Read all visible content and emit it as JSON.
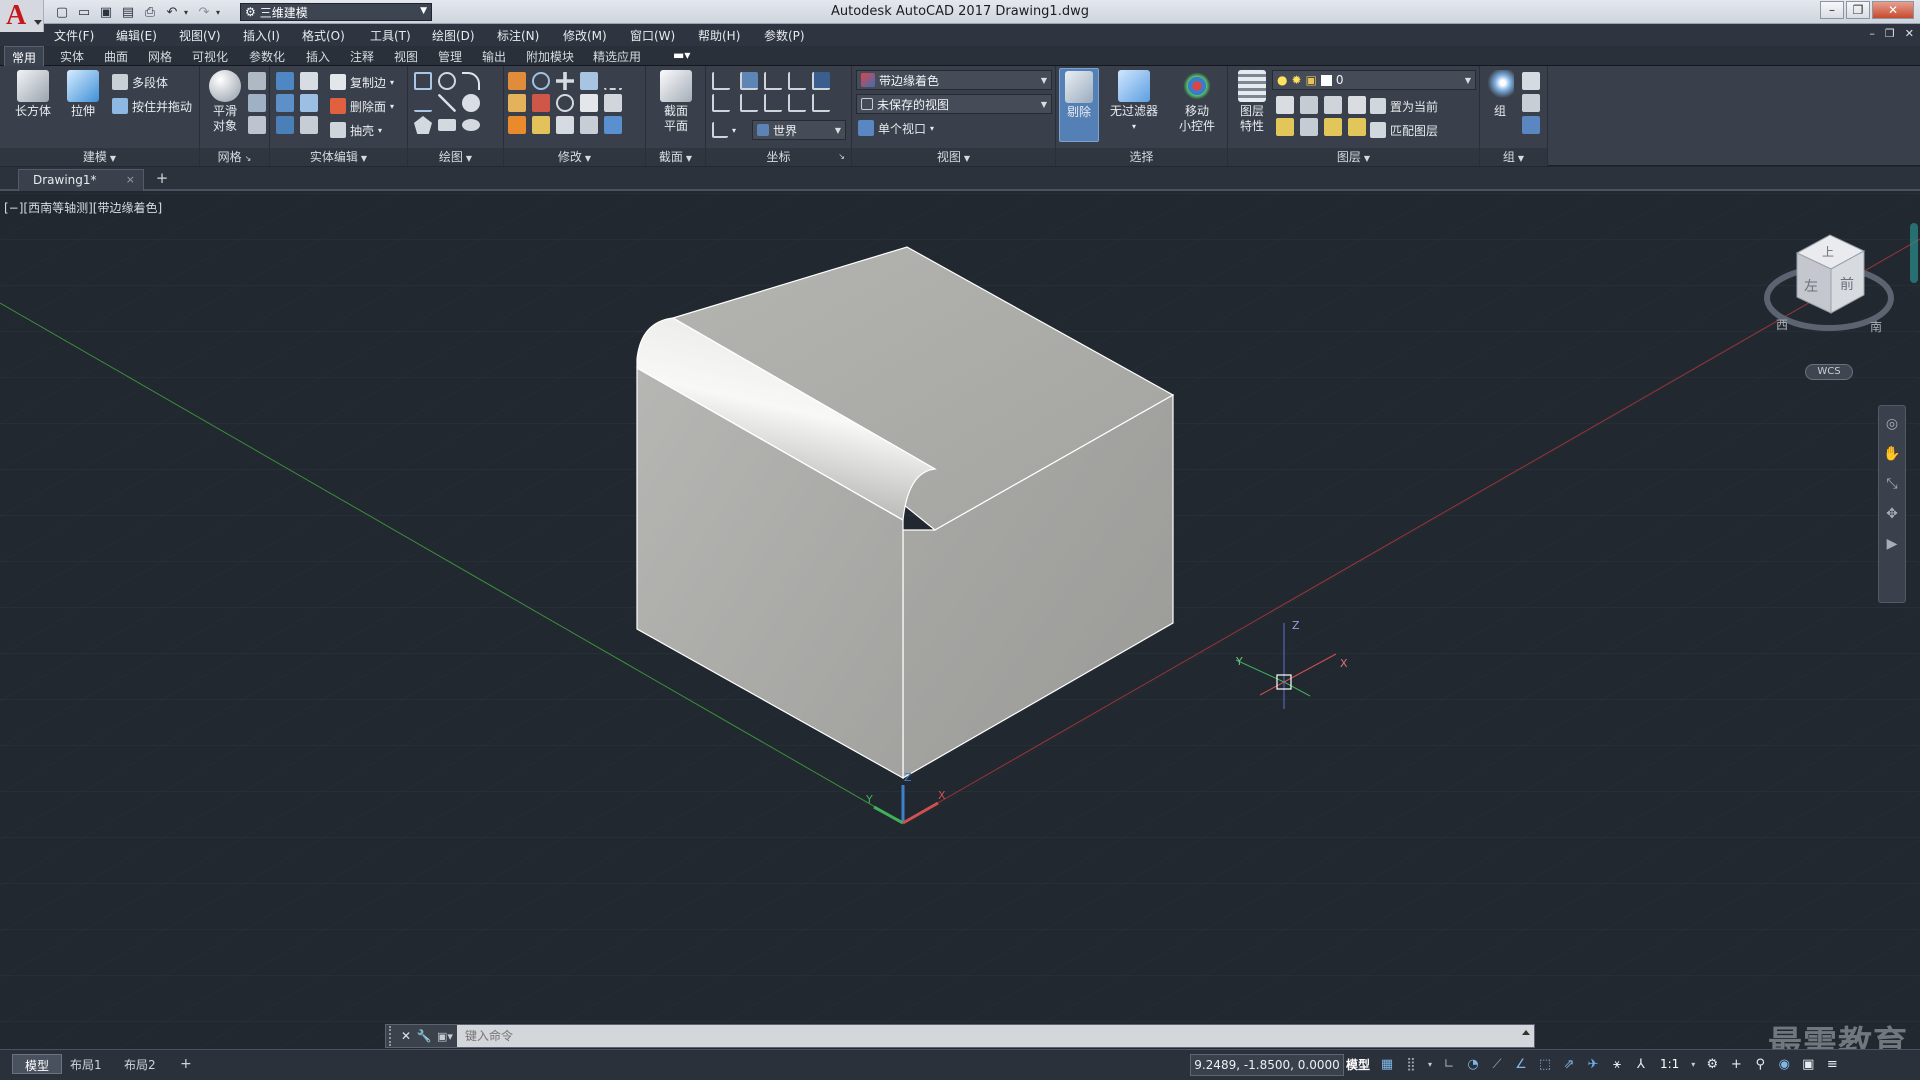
{
  "window": {
    "title": "Autodesk AutoCAD 2017    Drawing1.dwg",
    "app_logo": "A",
    "workspace": "三维建模"
  },
  "menubar": {
    "items": [
      "文件(F)",
      "编辑(E)",
      "视图(V)",
      "插入(I)",
      "格式(O)",
      "工具(T)",
      "绘图(D)",
      "标注(N)",
      "修改(M)",
      "窗口(W)",
      "帮助(H)",
      "参数(P)"
    ]
  },
  "ribbon_tabs": [
    "常用",
    "实体",
    "曲面",
    "网格",
    "可视化",
    "参数化",
    "插入",
    "注释",
    "视图",
    "管理",
    "输出",
    "附加模块",
    "精选应用"
  ],
  "ribbon": {
    "modeling": {
      "title": "建模",
      "box": "长方体",
      "extrude": "拉伸",
      "polysolid": "多段体",
      "presspull": "按住并拖动"
    },
    "mesh": {
      "title": "网格",
      "smooth_line1": "平滑",
      "smooth_line2": "对象"
    },
    "solid_edit": {
      "title": "实体编辑",
      "copy_edges": "复制边",
      "delete_face": "删除面",
      "shell": "抽壳"
    },
    "draw": {
      "title": "绘图"
    },
    "modify": {
      "title": "修改"
    },
    "section": {
      "title": "截面",
      "plane_line1": "截面",
      "plane_line2": "平面"
    },
    "coordinates": {
      "title": "坐标",
      "ucs_value": "世界"
    },
    "view": {
      "title": "视图",
      "visual_style": "带边缘着色",
      "named_view": "未保存的视图",
      "viewport_config": "单个视口"
    },
    "selection": {
      "title": "选择",
      "cull": "剔除",
      "no_filter": "无过滤器",
      "gizmo_line1": "移动",
      "gizmo_line2": "小控件"
    },
    "layers": {
      "title": "图层",
      "properties_line1": "图层",
      "properties_line2": "特性",
      "current_layer": "0",
      "make_current": "置为当前",
      "match_layer": "匹配图层"
    },
    "groups": {
      "title": "组",
      "group": "组"
    }
  },
  "document_tab": {
    "label": "Drawing1*",
    "close": "×",
    "add": "+"
  },
  "viewport": {
    "label": "[−][西南等轴测][带边缘着色]",
    "viewcube": {
      "top_face": "上",
      "left_face": "左",
      "front_face": "前",
      "compass_west": "西",
      "compass_south": "南"
    },
    "wcs": "WCS",
    "ucs_icon_labels": {
      "x": "X",
      "y": "Y",
      "z": "Z"
    },
    "cursor_axis_labels": {
      "x": "X",
      "y": "Y",
      "z": "Z"
    }
  },
  "command_line": {
    "placeholder": "键入命令"
  },
  "statusbar": {
    "layout_tabs": [
      "模型",
      "布局1",
      "布局2"
    ],
    "add_layout": "+",
    "coordinates": "9.2489, -1.8500, 0.0000",
    "model_space": "模型",
    "annotation_scale": "1:1"
  },
  "watermark": "最需教育"
}
